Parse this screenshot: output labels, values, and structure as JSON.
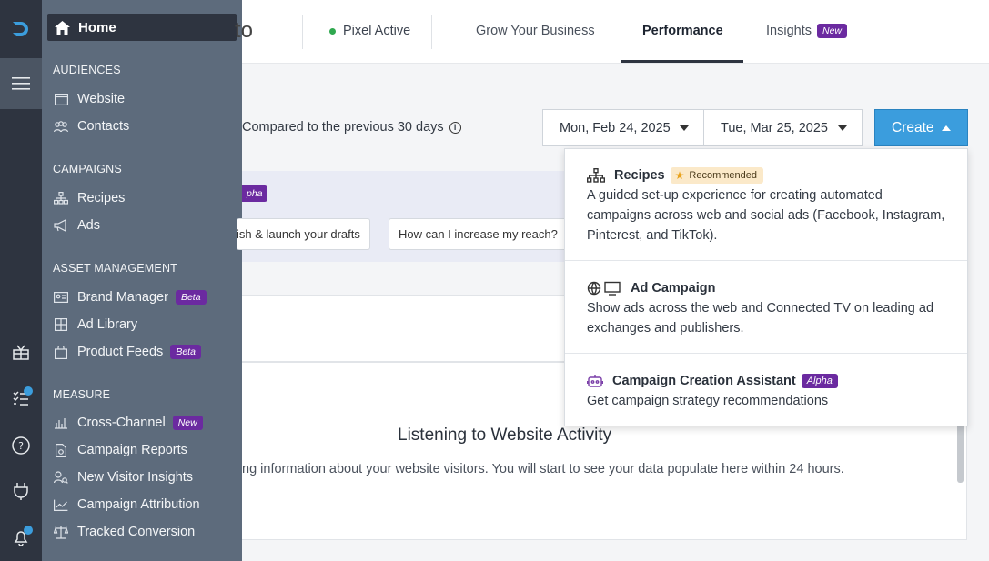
{
  "sidebar": {
    "home_label": "Home",
    "sections": [
      {
        "title": "AUDIENCES",
        "items": [
          {
            "label": "Website",
            "icon": "browser-icon"
          },
          {
            "label": "Contacts",
            "icon": "contacts-icon"
          }
        ]
      },
      {
        "title": "CAMPAIGNS",
        "items": [
          {
            "label": "Recipes",
            "icon": "hierarchy-icon"
          },
          {
            "label": "Ads",
            "icon": "megaphone-icon"
          }
        ]
      },
      {
        "title": "ASSET MANAGEMENT",
        "items": [
          {
            "label": "Brand Manager",
            "badge": "Beta"
          },
          {
            "label": "Ad Library"
          },
          {
            "label": "Product Feeds",
            "badge": "Beta"
          }
        ]
      },
      {
        "title": "MEASURE",
        "items": [
          {
            "label": "Cross-Channel",
            "badge": "New"
          },
          {
            "label": "Campaign Reports"
          },
          {
            "label": "New Visitor Insights"
          },
          {
            "label": "Campaign Attribution"
          },
          {
            "label": "Tracked Conversion"
          }
        ]
      }
    ]
  },
  "topbar": {
    "brand_tail": "to",
    "pixel_status": "Pixel Active",
    "nav": [
      {
        "label": "Grow Your Business"
      },
      {
        "label": "Performance"
      },
      {
        "label": "Insights",
        "badge": "New"
      }
    ]
  },
  "toolbar": {
    "compared_text": "Compared to the previous 30 days",
    "start_date": "Mon, Feb 24, 2025",
    "end_date": "Tue, Mar 25, 2025",
    "create_label": "Create"
  },
  "assistant": {
    "badge_tail": "pha",
    "chips": [
      "ish & launch your drafts",
      "How can I increase my reach?"
    ]
  },
  "listening": {
    "title": "Listening to Website Activity",
    "subtitle": "ng information about your website visitors. You will start to see your data populate here within 24 hours."
  },
  "dropdown": {
    "items": [
      {
        "title": "Recipes",
        "badge": "Recommended",
        "desc": "A guided set-up experience for creating automated campaigns across web and social ads (Facebook, Instagram, Pinterest, and TikTok)."
      },
      {
        "title": "Ad Campaign",
        "desc": "Show ads across the web and Connected TV on leading ad exchanges and publishers."
      },
      {
        "title": "Campaign Creation Assistant",
        "badge": "Alpha",
        "desc": "Get campaign strategy recommendations"
      }
    ]
  },
  "colors": {
    "accent": "#3b9ddd",
    "rail": "#2e3440",
    "flyout": "#5d6b7c",
    "badge_purple": "#6b2aa0"
  }
}
